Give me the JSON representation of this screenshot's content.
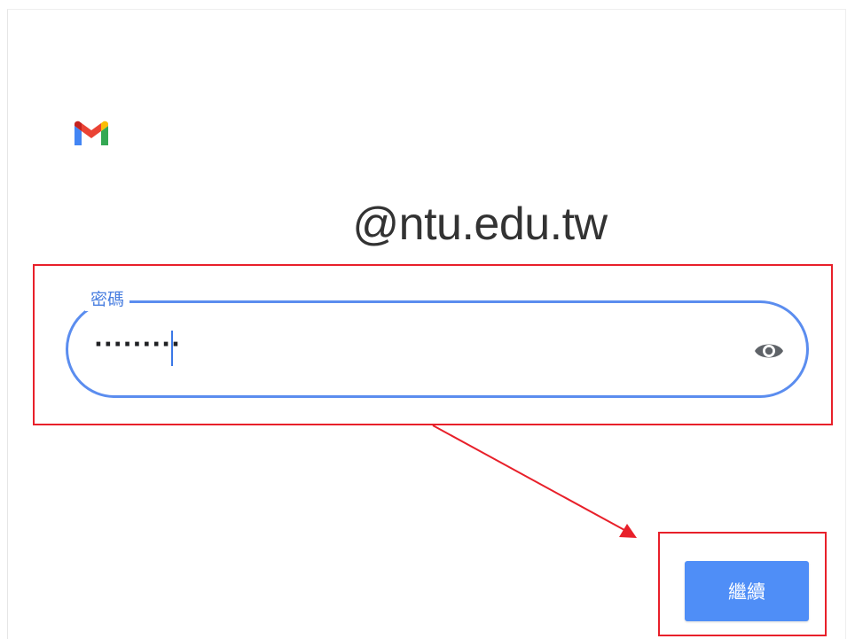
{
  "account": {
    "email": "@ntu.edu.tw"
  },
  "password_field": {
    "label": "密碼",
    "masked_value": "·········"
  },
  "actions": {
    "continue_label": "繼續"
  },
  "icons": {
    "logo": "gmail-logo-icon",
    "toggle_visibility": "eye-icon"
  },
  "colors": {
    "accent": "#4f8ef7",
    "field_border": "#5b8def",
    "annotation": "#e8202a"
  }
}
